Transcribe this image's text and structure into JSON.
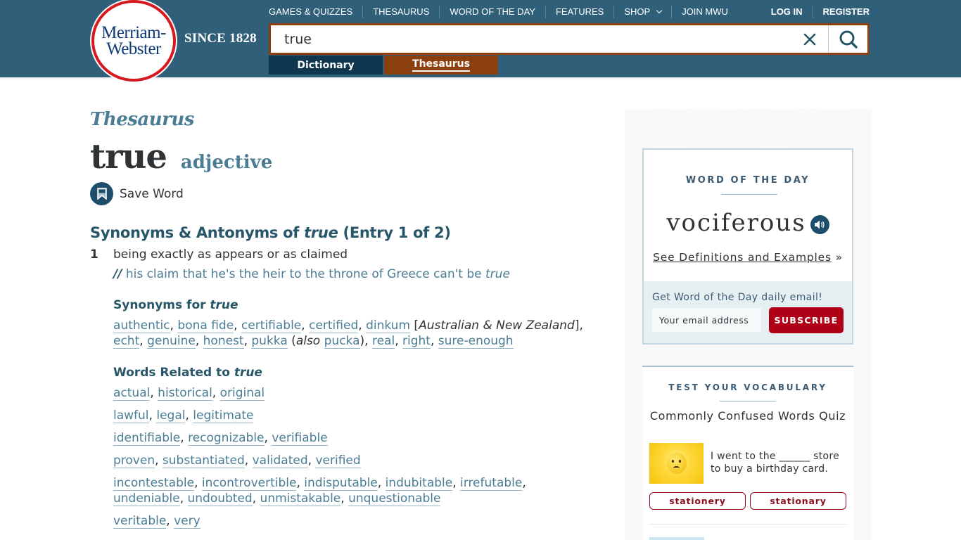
{
  "header": {
    "logo_line1": "Merriam-",
    "logo_line2": "Webster",
    "since": "SINCE 1828",
    "nav": [
      {
        "label": "GAMES & QUIZZES"
      },
      {
        "label": "THESAURUS"
      },
      {
        "label": "WORD OF THE DAY"
      },
      {
        "label": "FEATURES"
      },
      {
        "label": "SHOP",
        "has_dropdown": true
      },
      {
        "label": "JOIN MWU"
      }
    ],
    "auth": {
      "login": "LOG IN",
      "register": "REGISTER"
    },
    "search": {
      "value": "true",
      "placeholder": ""
    },
    "tabs": {
      "dictionary": "Dictionary",
      "thesaurus": "Thesaurus",
      "active": "thesaurus"
    },
    "icons": {
      "clear": "close-icon",
      "search": "search-icon"
    }
  },
  "entry": {
    "brand": "Thesaurus",
    "headword": "true",
    "part_of_speech": "adjective",
    "save_label": "Save Word",
    "section_title_pre": "Synonyms & Antonyms of ",
    "section_title_word": "true",
    "section_title_post": " (Entry 1 of 2)",
    "sense": {
      "number": "1",
      "definition": "being exactly as appears or as claimed",
      "example_marker": "//",
      "example_text": " his claim that he's the heir to the throne of Greece can't be ",
      "example_word": "true"
    },
    "synonyms_title_pre": "Synonyms for ",
    "synonyms_title_word": "true",
    "synonyms": [
      "authentic",
      "bona fide",
      "certifiable",
      "certified",
      "dinkum",
      "echt",
      "genuine",
      "honest",
      "pukka",
      "pucka",
      "real",
      "right",
      "sure-enough"
    ],
    "synonym_notes": {
      "dinkum_label": "Australian & New Zealand",
      "pukka_also": "also"
    },
    "related_title_pre": "Words Related to ",
    "related_title_word": "true",
    "related_groups": [
      [
        "actual",
        "historical",
        "original"
      ],
      [
        "lawful",
        "legal",
        "legitimate"
      ],
      [
        "identifiable",
        "recognizable",
        "verifiable"
      ],
      [
        "proven",
        "substantiated",
        "validated",
        "verified"
      ],
      [
        "incontestable",
        "incontrovertible",
        "indisputable",
        "indubitable",
        "irrefutable",
        "undeniable",
        "undoubted",
        "unmistakable",
        "unquestionable"
      ],
      [
        "veritable",
        "very"
      ]
    ]
  },
  "sidebar": {
    "wod": {
      "kicker": "WORD OF THE DAY",
      "word": "vociferous",
      "link": "See Definitions and Examples",
      "link_suffix": "»",
      "signup_label": "Get Word of the Day daily email!",
      "email_placeholder": "Your email address",
      "subscribe": "SUBSCRIBE"
    },
    "vocab": {
      "kicker": "TEST YOUR VOCABULARY",
      "title": "Commonly Confused Words Quiz",
      "question": "I went to the ______ store to buy a birthday card.",
      "options": [
        "stationery",
        "stationary"
      ]
    }
  },
  "colors": {
    "header_bg": "#305f7a",
    "accent_brown": "#8b3e0e",
    "dictionary_tab": "#0f3850",
    "link_blue": "#4a7d95",
    "subscribe_red": "#b00018",
    "logo_red": "#d71920"
  }
}
